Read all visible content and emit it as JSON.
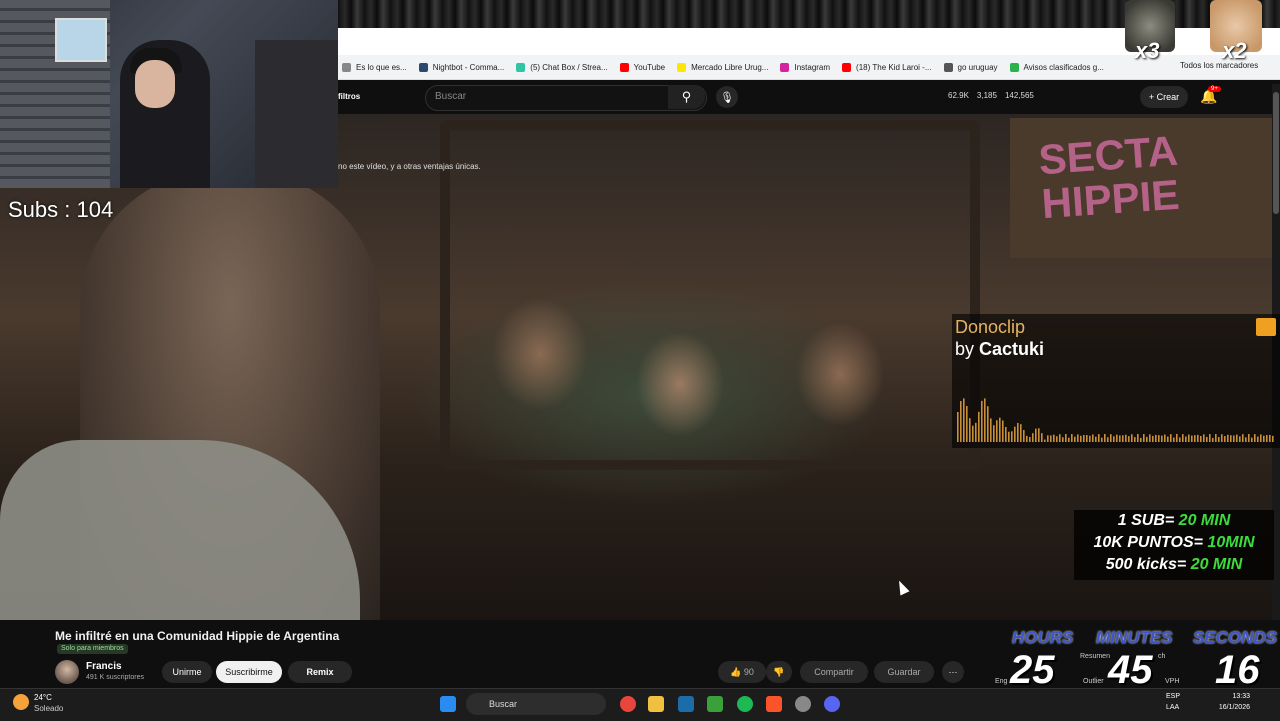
{
  "browser": {
    "bookmarks": [
      {
        "label": "Es lo que es...",
        "icon": "page-icon",
        "color": "#888888"
      },
      {
        "label": "Nightbot - Comma...",
        "icon": "nightbot-icon",
        "color": "#2b4a6e"
      },
      {
        "label": "(5) Chat Box / Strea...",
        "icon": "streamlabs-icon",
        "color": "#31c3a2"
      },
      {
        "label": "YouTube",
        "icon": "youtube-icon",
        "color": "#ff0000"
      },
      {
        "label": "Mercado Libre Urug...",
        "icon": "mercadolibre-icon",
        "color": "#ffe600"
      },
      {
        "label": "Instagram",
        "icon": "instagram-icon",
        "color": "#d6249f"
      },
      {
        "label": "(18) The Kid Laroi -...",
        "icon": "youtube-icon",
        "color": "#ff0000"
      },
      {
        "label": "go uruguay",
        "icon": "globe-icon",
        "color": "#555555"
      },
      {
        "label": "Avisos clasificados g...",
        "icon": "gallito-icon",
        "color": "#2cb24a"
      }
    ],
    "all_bookmarks_label": "Todos los marcadores"
  },
  "youtube_header": {
    "filters_label": "filtros",
    "search_placeholder": "Buscar",
    "stats": [
      "62.9K",
      "3,185",
      "142,565"
    ],
    "create_label": "Crear",
    "notif_badge": "9+"
  },
  "video": {
    "members_hint": "no este vídeo, y a otras ventajas únicas.",
    "sign_text": "SECTA HIPPIE"
  },
  "stream_overlay": {
    "subs_label": "Subs : 104",
    "multipliers": [
      "x3",
      "x2"
    ],
    "donoclip_title": "Donoclip",
    "donoclip_by": "by",
    "donoclip_user": "Cactuki",
    "rules": [
      {
        "prefix": "1 SUB= ",
        "value": "20 MIN"
      },
      {
        "prefix": "10K PUNTOS= ",
        "value": "10MIN"
      },
      {
        "prefix": "500 kicks= ",
        "value": "20 MIN"
      }
    ],
    "timer": {
      "hours_label": "HOURS",
      "hours": "25",
      "minutes_label": "MINUTES",
      "minutes": "45",
      "seconds_label": "SECONDS",
      "seconds": "16"
    }
  },
  "video_info": {
    "title": "Me infiltré en una Comunidad Hippie de Argentina",
    "members_badge": "Solo para miembros",
    "channel_name": "Francis",
    "channel_subs": "491 K suscriptores",
    "join_label": "Unirme",
    "subscribe_label": "Suscribirme",
    "remix_label": "Remix",
    "like_count": "90",
    "share_label": "Compartir",
    "save_label": "Guardar",
    "extension_labels": [
      "Resumen",
      "ch",
      "Eng",
      "Outlier",
      "VPH"
    ]
  },
  "taskbar": {
    "temperature": "24°C",
    "weather": "Soleado",
    "search_label": "Buscar",
    "lang_line1": "ESP",
    "lang_line2": "LAA",
    "time": "13:33",
    "date": "16/1/2026"
  },
  "colors": {
    "accent_green": "#3ddc3d",
    "donoclip_gold": "#e6b360",
    "timer_blue": "#3d55c8"
  }
}
